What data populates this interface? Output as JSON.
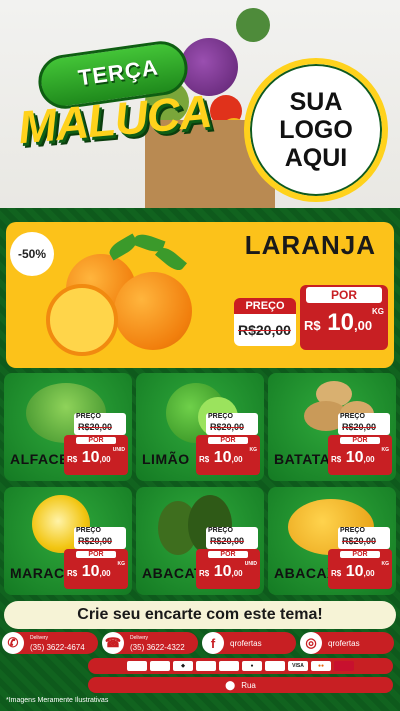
{
  "hero": {
    "title_line1": "TERÇA",
    "title_line2": "MALUCA",
    "logo_lines": [
      "SUA",
      "LOGO",
      "AQUI"
    ]
  },
  "featured": {
    "discount": "-50%",
    "name": "LARANJA",
    "old_label": "PREÇO",
    "old_price": "R$20,00",
    "new_label": "POR",
    "currency": "R$",
    "price_int": "10",
    "price_dec": ",00",
    "unit": "KG"
  },
  "products": [
    {
      "name": "ALFACE",
      "old_label": "PREÇO",
      "old_price": "R$20,00",
      "new_label": "POR",
      "currency": "R$",
      "price_int": "10",
      "price_dec": ",00",
      "unit": "UNID"
    },
    {
      "name": "LIMÃO",
      "old_label": "PREÇO",
      "old_price": "R$20,00",
      "new_label": "POR",
      "currency": "R$",
      "price_int": "10",
      "price_dec": ",00",
      "unit": "KG"
    },
    {
      "name": "BATATA",
      "old_label": "PREÇO",
      "old_price": "R$20,00",
      "new_label": "POR",
      "currency": "R$",
      "price_int": "10",
      "price_dec": ",00",
      "unit": "KG"
    },
    {
      "name": "MARACUJÁ",
      "old_label": "PREÇO",
      "old_price": "R$20,00",
      "new_label": "POR",
      "currency": "R$",
      "price_int": "10",
      "price_dec": ",00",
      "unit": "KG"
    },
    {
      "name": "ABACATE",
      "old_label": "PREÇO",
      "old_price": "R$20,00",
      "new_label": "POR",
      "currency": "R$",
      "price_int": "10",
      "price_dec": ",00",
      "unit": "UNID"
    },
    {
      "name": "ABACAXI",
      "old_label": "PREÇO",
      "old_price": "R$20,00",
      "new_label": "POR",
      "currency": "R$",
      "price_int": "10",
      "price_dec": ",00",
      "unit": "KG"
    }
  ],
  "cta": "Crie seu encarte com este tema!",
  "contacts": [
    {
      "icon": "whatsapp-icon",
      "label": "Delivery",
      "value": "(35) 3622-4674"
    },
    {
      "icon": "phone-icon",
      "label": "Delivery",
      "value": "(35) 3622-4322"
    },
    {
      "icon": "facebook-icon",
      "label": "",
      "value": "qrofertas"
    },
    {
      "icon": "instagram-icon",
      "label": "",
      "value": "qrofertas"
    }
  ],
  "payment_methods": [
    "card-icon",
    "card-icon",
    "pix-icon",
    "card-icon",
    "card-icon",
    "elo-icon",
    "card-icon",
    "VISA",
    "mastercard-icon",
    "hipercard-icon"
  ],
  "address": "Rua",
  "disclaimer": "*Imagens Meramente Ilustrativas",
  "colors": {
    "green_dark": "#0f5a1e",
    "yellow": "#fcc21a",
    "red": "#c81f23",
    "cream": "#f6f3d6"
  }
}
